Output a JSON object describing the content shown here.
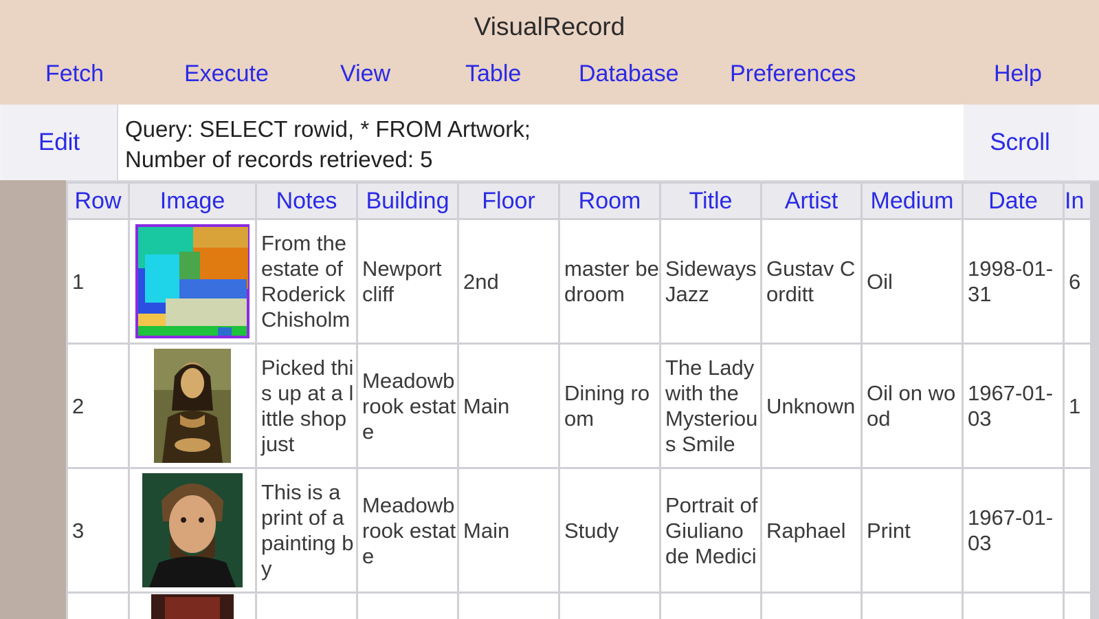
{
  "app": {
    "title": "VisualRecord"
  },
  "menu": {
    "fetch": "Fetch",
    "execute": "Execute",
    "view": "View",
    "table": "Table",
    "database": "Database",
    "preferences": "Preferences",
    "help": "Help"
  },
  "toolbar": {
    "edit_label": "Edit",
    "scroll_label": "Scroll",
    "query_line": "Query: SELECT rowid, * FROM Artwork;",
    "count_line": "Number of records retrieved: 5"
  },
  "table": {
    "columns": [
      "Row",
      "Image",
      "Notes",
      "Building",
      "Floor",
      "Room",
      "Title",
      "Artist",
      "Medium",
      "Date",
      "In"
    ],
    "rows": [
      {
        "row": "1",
        "image": "abstract-color-blocks-thumbnail",
        "notes": "From the estate of Roderick Chisholm",
        "building": "Newport cliff",
        "floor": "2nd",
        "room": "master bedroom",
        "title": "Sideways Jazz",
        "artist": "Gustav Corditt",
        "medium": "Oil",
        "date": "1998-01-31",
        "extra": "6"
      },
      {
        "row": "2",
        "image": "mona-lisa-thumbnail",
        "notes": "Picked this up at a little shop just",
        "building": "Meadowbrook estate",
        "floor": "Main",
        "room": "Dining room",
        "title": "The Lady with the Mysterious Smile",
        "artist": "Unknown",
        "medium": "Oil on wood",
        "date": "1967-01-03",
        "extra": "1"
      },
      {
        "row": "3",
        "image": "portrait-giuliano-thumbnail",
        "notes": "This is a print of a painting by",
        "building": "Meadowbrook estate",
        "floor": "Main",
        "room": "Study",
        "title": "Portrait of Giuliano de Medici",
        "artist": "Raphael",
        "medium": "Print",
        "date": "1967-01-03",
        "extra": ""
      }
    ]
  },
  "colors": {
    "titlebar_bg": "#ead4c4",
    "link_blue": "#2a2ae6",
    "gutter": "#bcaea4"
  }
}
